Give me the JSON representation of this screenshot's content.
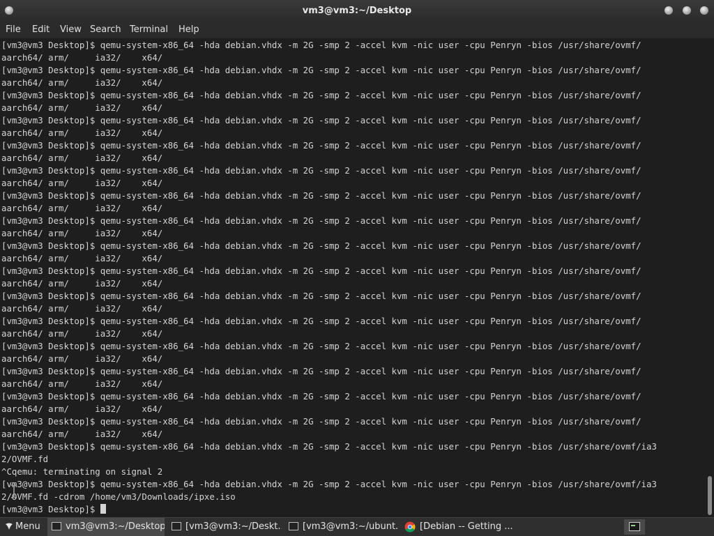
{
  "window": {
    "title": "vm3@vm3:~/Desktop"
  },
  "menubar": {
    "file": "File",
    "edit": "Edit",
    "view": "View",
    "search": "Search",
    "terminal": "Terminal",
    "help": "Help"
  },
  "terminal": {
    "lines": [
      "[vm3@vm3 Desktop]$ qemu-system-x86_64 -hda debian.vhdx -m 2G -smp 2 -accel kvm -nic user -cpu Penryn -bios /usr/share/ovmf/",
      "aarch64/ arm/     ia32/    x64/",
      "[vm3@vm3 Desktop]$ qemu-system-x86_64 -hda debian.vhdx -m 2G -smp 2 -accel kvm -nic user -cpu Penryn -bios /usr/share/ovmf/",
      "aarch64/ arm/     ia32/    x64/",
      "[vm3@vm3 Desktop]$ qemu-system-x86_64 -hda debian.vhdx -m 2G -smp 2 -accel kvm -nic user -cpu Penryn -bios /usr/share/ovmf/",
      "aarch64/ arm/     ia32/    x64/",
      "[vm3@vm3 Desktop]$ qemu-system-x86_64 -hda debian.vhdx -m 2G -smp 2 -accel kvm -nic user -cpu Penryn -bios /usr/share/ovmf/",
      "aarch64/ arm/     ia32/    x64/",
      "[vm3@vm3 Desktop]$ qemu-system-x86_64 -hda debian.vhdx -m 2G -smp 2 -accel kvm -nic user -cpu Penryn -bios /usr/share/ovmf/",
      "aarch64/ arm/     ia32/    x64/",
      "[vm3@vm3 Desktop]$ qemu-system-x86_64 -hda debian.vhdx -m 2G -smp 2 -accel kvm -nic user -cpu Penryn -bios /usr/share/ovmf/",
      "aarch64/ arm/     ia32/    x64/",
      "[vm3@vm3 Desktop]$ qemu-system-x86_64 -hda debian.vhdx -m 2G -smp 2 -accel kvm -nic user -cpu Penryn -bios /usr/share/ovmf/",
      "aarch64/ arm/     ia32/    x64/",
      "[vm3@vm3 Desktop]$ qemu-system-x86_64 -hda debian.vhdx -m 2G -smp 2 -accel kvm -nic user -cpu Penryn -bios /usr/share/ovmf/",
      "aarch64/ arm/     ia32/    x64/",
      "[vm3@vm3 Desktop]$ qemu-system-x86_64 -hda debian.vhdx -m 2G -smp 2 -accel kvm -nic user -cpu Penryn -bios /usr/share/ovmf/",
      "aarch64/ arm/     ia32/    x64/",
      "[vm3@vm3 Desktop]$ qemu-system-x86_64 -hda debian.vhdx -m 2G -smp 2 -accel kvm -nic user -cpu Penryn -bios /usr/share/ovmf/",
      "aarch64/ arm/     ia32/    x64/",
      "[vm3@vm3 Desktop]$ qemu-system-x86_64 -hda debian.vhdx -m 2G -smp 2 -accel kvm -nic user -cpu Penryn -bios /usr/share/ovmf/",
      "aarch64/ arm/     ia32/    x64/",
      "[vm3@vm3 Desktop]$ qemu-system-x86_64 -hda debian.vhdx -m 2G -smp 2 -accel kvm -nic user -cpu Penryn -bios /usr/share/ovmf/",
      "aarch64/ arm/     ia32/    x64/",
      "[vm3@vm3 Desktop]$ qemu-system-x86_64 -hda debian.vhdx -m 2G -smp 2 -accel kvm -nic user -cpu Penryn -bios /usr/share/ovmf/",
      "aarch64/ arm/     ia32/    x64/",
      "[vm3@vm3 Desktop]$ qemu-system-x86_64 -hda debian.vhdx -m 2G -smp 2 -accel kvm -nic user -cpu Penryn -bios /usr/share/ovmf/",
      "aarch64/ arm/     ia32/    x64/",
      "[vm3@vm3 Desktop]$ qemu-system-x86_64 -hda debian.vhdx -m 2G -smp 2 -accel kvm -nic user -cpu Penryn -bios /usr/share/ovmf/",
      "aarch64/ arm/     ia32/    x64/",
      "[vm3@vm3 Desktop]$ qemu-system-x86_64 -hda debian.vhdx -m 2G -smp 2 -accel kvm -nic user -cpu Penryn -bios /usr/share/ovmf/",
      "aarch64/ arm/     ia32/    x64/",
      "[vm3@vm3 Desktop]$ qemu-system-x86_64 -hda debian.vhdx -m 2G -smp 2 -accel kvm -nic user -cpu Penryn -bios /usr/share/ovmf/ia3",
      "2/OVMF.fd",
      "^Cqemu: terminating on signal 2",
      "[vm3@vm3 Desktop]$ qemu-system-x86_64 -hda debian.vhdx -m 2G -smp 2 -accel kvm -nic user -cpu Penryn -bios /usr/share/ovmf/ia3",
      "2/OVMF.fd -cdrom /home/vm3/Downloads/ipxe.iso",
      "[vm3@vm3 Desktop]$ "
    ],
    "colors": {
      "background": "#1e1e1e",
      "foreground": "#d4d4d4"
    }
  },
  "taskbar": {
    "start_label": "Menu",
    "tasks": [
      {
        "label": "vm3@vm3:~/Desktop",
        "icon": "terminal-icon",
        "active": true
      },
      {
        "label": "[vm3@vm3:~/Deskt...",
        "icon": "terminal-icon",
        "active": false
      },
      {
        "label": "[vm3@vm3:~/ubunt...",
        "icon": "terminal-icon",
        "active": false
      },
      {
        "label": "[Debian -- Getting ...",
        "icon": "chrome-icon",
        "active": false
      }
    ],
    "tray_icon": "terminal-icon"
  }
}
